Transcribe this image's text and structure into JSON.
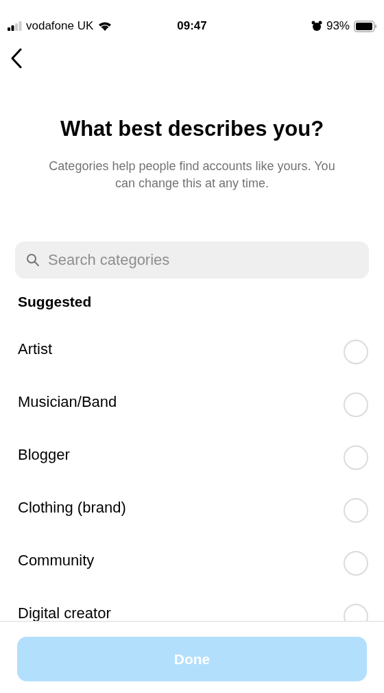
{
  "status_bar": {
    "carrier": "vodafone UK",
    "time": "09:47",
    "battery": "93%"
  },
  "title": "What best describes you?",
  "subtitle": "Categories help people find accounts like yours. You can change this at any time.",
  "search": {
    "placeholder": "Search categories"
  },
  "section_title": "Suggested",
  "categories": [
    {
      "label": "Artist",
      "selected": false
    },
    {
      "label": "Musician/Band",
      "selected": false
    },
    {
      "label": "Blogger",
      "selected": false
    },
    {
      "label": "Clothing (brand)",
      "selected": false
    },
    {
      "label": "Community",
      "selected": false
    },
    {
      "label": "Digital creator",
      "selected": false
    }
  ],
  "done_button": {
    "label": "Done",
    "disabled": true
  }
}
